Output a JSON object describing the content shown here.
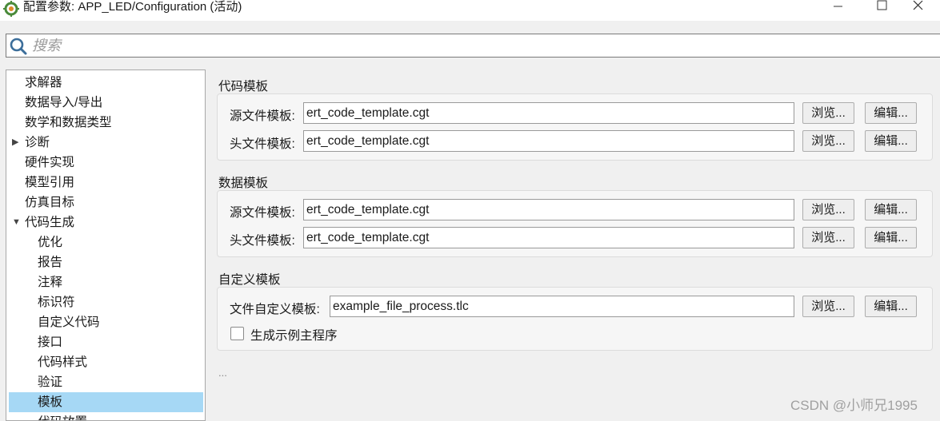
{
  "window": {
    "title": "配置参数: APP_LED/Configuration (活动)"
  },
  "search": {
    "placeholder": "搜索"
  },
  "tree": {
    "items": [
      {
        "label": "求解器"
      },
      {
        "label": "数据导入/导出"
      },
      {
        "label": "数学和数据类型"
      },
      {
        "label": "诊断",
        "expander": "▶"
      },
      {
        "label": "硬件实现"
      },
      {
        "label": "模型引用"
      },
      {
        "label": "仿真目标"
      },
      {
        "label": "代码生成",
        "expander": "▼"
      },
      {
        "label": "优化"
      },
      {
        "label": "报告"
      },
      {
        "label": "注释"
      },
      {
        "label": "标识符"
      },
      {
        "label": "自定义代码"
      },
      {
        "label": "接口"
      },
      {
        "label": "代码样式"
      },
      {
        "label": "验证"
      },
      {
        "label": "模板",
        "selected": true
      },
      {
        "label": "代码放置"
      }
    ]
  },
  "sections": [
    {
      "title": "代码模板",
      "rows": [
        {
          "label": "源文件模板:",
          "value": "ert_code_template.cgt",
          "browse": "浏览...",
          "edit": "编辑..."
        },
        {
          "label": "头文件模板:",
          "value": "ert_code_template.cgt",
          "browse": "浏览...",
          "edit": "编辑..."
        }
      ]
    },
    {
      "title": "数据模板",
      "rows": [
        {
          "label": "源文件模板:",
          "value": "ert_code_template.cgt",
          "browse": "浏览...",
          "edit": "编辑..."
        },
        {
          "label": "头文件模板:",
          "value": "ert_code_template.cgt",
          "browse": "浏览...",
          "edit": "编辑..."
        }
      ]
    },
    {
      "title": "自定义模板",
      "rows": [
        {
          "label": "文件自定义模板:",
          "value": "example_file_process.tlc",
          "browse": "浏览...",
          "edit": "编辑..."
        }
      ],
      "checkbox": {
        "label": "生成示例主程序",
        "checked": false
      }
    }
  ],
  "ellipsis": "...",
  "watermark": "CSDN @小师兄1995",
  "colors": {
    "selected_bg": "#a6d8f5",
    "accent": "#1e6fbf"
  },
  "icons": [
    "app-icon",
    "minimize-icon",
    "maximize-icon",
    "close-icon",
    "search-icon",
    "expand-arrow-icon",
    "collapse-arrow-icon"
  ]
}
